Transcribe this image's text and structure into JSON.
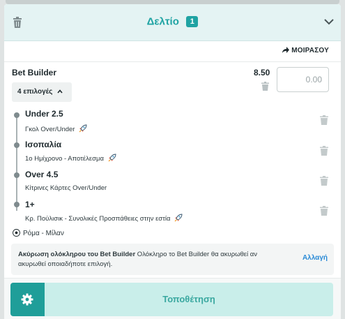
{
  "header": {
    "title": "Δελτίο",
    "count": "1"
  },
  "share_label": "ΜΟΙΡΑΣΟΥ",
  "bet_builder": {
    "title": "Bet Builder",
    "odds": "8.50",
    "stake_placeholder": "0.00",
    "selections_toggle": "4 επιλογές"
  },
  "selections": [
    {
      "title": "Under 2.5",
      "market": "Γκολ Over/Under",
      "boosted": true
    },
    {
      "title": "Ισοπαλία",
      "market": "1ο Ημίχρονο - Αποτέλεσμα",
      "boosted": true
    },
    {
      "title": "Over 4.5",
      "market": "Κίτρινες Κάρτες Over/Under",
      "boosted": false
    },
    {
      "title": "1+",
      "market": "Κρ. Πούλισικ - Συνολικές Προσπάθειες στην εστία",
      "boosted": true
    }
  ],
  "match": "Ρόμα  -  Μίλαν",
  "notice": {
    "bold": "Ακύρωση ολόκληρου του Bet Builder",
    "text": " Ολόκληρο το Bet Builder θα ακυρωθεί αν ακυρωθεί οποιαδήποτε επιλογή.",
    "action": "Αλλαγή"
  },
  "place_button": "Τοποθέτηση",
  "colors": {
    "accent": "#1fa3a3",
    "header_bg": "#e4f3f3",
    "place_bg": "#c9eeea",
    "link": "#2a8ad6"
  },
  "icons": [
    "trash-icon",
    "chevron-down-icon",
    "share-arrow-icon",
    "chevron-up-icon",
    "rocket-icon",
    "football-icon",
    "gear-icon"
  ]
}
